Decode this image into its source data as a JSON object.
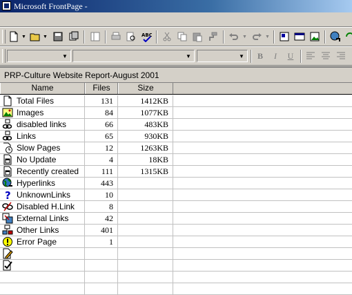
{
  "window": {
    "title": "Microsoft FrontPage -"
  },
  "format_toolbar": {
    "bold": "B",
    "italic": "I",
    "underline": "U"
  },
  "report": {
    "caption": "PRP-Culture Website Report-August 2001",
    "columns": {
      "name": "Name",
      "files": "Files",
      "size": "Size"
    },
    "rows": [
      {
        "icon": "page-icon",
        "name": "Total Files",
        "files": "131",
        "size": "1412KB"
      },
      {
        "icon": "image-icon",
        "name": "Images",
        "files": "84",
        "size": "1077KB"
      },
      {
        "icon": "chain-link-icon",
        "name": "disabled links",
        "files": "66",
        "size": "483KB"
      },
      {
        "icon": "chain-link-icon",
        "name": "Links",
        "files": "65",
        "size": "930KB"
      },
      {
        "icon": "clock-page-icon",
        "name": "Slow Pages",
        "files": "12",
        "size": "1263KB"
      },
      {
        "icon": "calendar-page-icon",
        "name": "No Update",
        "files": "4",
        "size": "18KB"
      },
      {
        "icon": "calendar-page-icon",
        "name": "Recently created",
        "files": "111",
        "size": "1315KB"
      },
      {
        "icon": "globe-icon",
        "name": "Hyperlinks",
        "files": "443",
        "size": ""
      },
      {
        "icon": "question-mark-icon",
        "name": "UnknownLinks",
        "files": "10",
        "size": ""
      },
      {
        "icon": "broken-link-icon",
        "name": "Disabled H.Link",
        "files": "8",
        "size": ""
      },
      {
        "icon": "external-link-icon",
        "name": "External Links",
        "files": "42",
        "size": ""
      },
      {
        "icon": "other-links-icon",
        "name": "Other Links",
        "files": "401",
        "size": ""
      },
      {
        "icon": "warning-icon",
        "name": "Error Page",
        "files": "1",
        "size": ""
      },
      {
        "icon": "pencil-page-icon",
        "name": "",
        "files": "",
        "size": ""
      },
      {
        "icon": "check-page-icon",
        "name": "",
        "files": "",
        "size": ""
      },
      {
        "icon": "",
        "name": "",
        "files": "",
        "size": ""
      },
      {
        "icon": "",
        "name": "",
        "files": "",
        "size": ""
      }
    ]
  }
}
